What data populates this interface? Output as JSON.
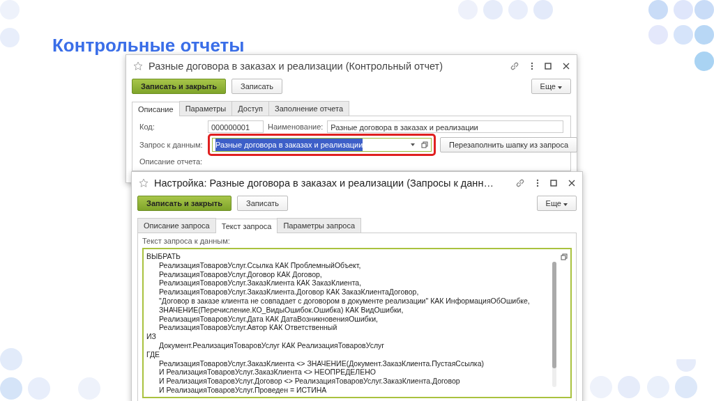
{
  "slide_title": "Контрольные отчеты",
  "window_report": {
    "title": "Разные договора в заказах и реализации (Контрольный отчет)",
    "buttons": [
      {
        "label": "Записать и закрыть",
        "kind": "primary"
      },
      {
        "label": "Записать",
        "kind": "normal"
      }
    ],
    "more_button": "Еще",
    "tabs": [
      {
        "label": "Описание",
        "selected": true
      },
      {
        "label": "Параметры",
        "selected": false
      },
      {
        "label": "Доступ",
        "selected": false
      },
      {
        "label": "Заполнение отчета",
        "selected": false
      }
    ],
    "code_label": "Код:",
    "code_value": "000000001",
    "name_label": "Наименование:",
    "name_value": "Разные договора в заказах и реализации",
    "query_label": "Запрос к данным:",
    "query_value": "Разные договора в заказах и реализации",
    "query_text_selected": true,
    "query_highlighted": true,
    "refill_button": "Перезаполнить шапку из запроса",
    "description_label": "Описание отчета:"
  },
  "window_settings": {
    "title": "Настройка: Разные договора в заказах и реализации (Запросы к данн…",
    "buttons": [
      {
        "label": "Записать и закрыть",
        "kind": "primary"
      },
      {
        "label": "Записать",
        "kind": "normal"
      }
    ],
    "more_button": "Еще",
    "tabs": [
      {
        "label": "Описание запроса",
        "selected": false
      },
      {
        "label": "Текст запроса",
        "selected": true
      },
      {
        "label": "Параметры запроса",
        "selected": false
      }
    ],
    "query_text_label": "Текст запроса к данным:",
    "query_lines": [
      {
        "text": "ВЫБРАТЬ",
        "indented": false
      },
      {
        "text": "РеализацияТоваровУслуг.Ссылка КАК ПроблемныйОбъект,",
        "indented": true
      },
      {
        "text": "РеализацияТоваровУслуг.Договор КАК Договор,",
        "indented": true
      },
      {
        "text": "РеализацияТоваровУслуг.ЗаказКлиента КАК ЗаказКлиента,",
        "indented": true
      },
      {
        "text": "РеализацияТоваровУслуг.ЗаказКлиента.Договор КАК ЗаказКлиентаДоговор,",
        "indented": true
      },
      {
        "text": "\"Договор в заказе клиента не совпадает с договором в документе реализации\" КАК ИнформацияОбОшибке,",
        "indented": true
      },
      {
        "text": "ЗНАЧЕНИЕ(Перечисление.КО_ВидыОшибок.Ошибка) КАК ВидОшибки,",
        "indented": true
      },
      {
        "text": "РеализацияТоваровУслуг.Дата КАК ДатаВозникновенияОшибки,",
        "indented": true
      },
      {
        "text": "РеализацияТоваровУслуг.Автор КАК Ответственный",
        "indented": true
      },
      {
        "text": "ИЗ",
        "indented": false
      },
      {
        "text": "Документ.РеализацияТоваровУслуг КАК РеализацияТоваровУслуг",
        "indented": true
      },
      {
        "text": "ГДЕ",
        "indented": false
      },
      {
        "text": "РеализацияТоваровУслуг.ЗаказКлиента <> ЗНАЧЕНИЕ(Документ.ЗаказКлиента.ПустаяСсылка)",
        "indented": true
      },
      {
        "text": "И РеализацияТоваровУслуг.ЗаказКлиента <> НЕОПРЕДЕЛЕНО",
        "indented": true
      },
      {
        "text": "И РеализацияТоваровУслуг.Договор <> РеализацияТоваровУслуг.ЗаказКлиента.Договор",
        "indented": true
      },
      {
        "text": "И РеализацияТоваровУслуг.Проведен = ИСТИНА",
        "indented": true
      }
    ]
  }
}
